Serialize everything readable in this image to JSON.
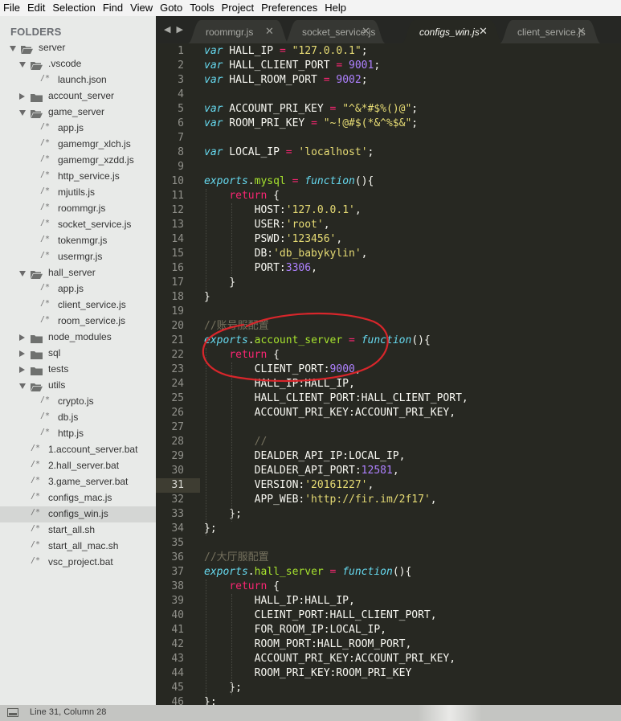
{
  "menubar": {
    "items": [
      "File",
      "Edit",
      "Selection",
      "Find",
      "View",
      "Goto",
      "Tools",
      "Project",
      "Preferences",
      "Help"
    ]
  },
  "sidebar": {
    "header": "FOLDERS",
    "tree": [
      {
        "label": "server",
        "type": "folder",
        "open": true,
        "depth": 0
      },
      {
        "label": ".vscode",
        "type": "folder",
        "open": true,
        "depth": 1
      },
      {
        "label": "launch.json",
        "type": "file",
        "depth": 2
      },
      {
        "label": "account_server",
        "type": "folder",
        "open": false,
        "depth": 1
      },
      {
        "label": "game_server",
        "type": "folder",
        "open": true,
        "depth": 1
      },
      {
        "label": "app.js",
        "type": "file",
        "depth": 2
      },
      {
        "label": "gamemgr_xlch.js",
        "type": "file",
        "depth": 2
      },
      {
        "label": "gamemgr_xzdd.js",
        "type": "file",
        "depth": 2
      },
      {
        "label": "http_service.js",
        "type": "file",
        "depth": 2
      },
      {
        "label": "mjutils.js",
        "type": "file",
        "depth": 2
      },
      {
        "label": "roommgr.js",
        "type": "file",
        "depth": 2
      },
      {
        "label": "socket_service.js",
        "type": "file",
        "depth": 2
      },
      {
        "label": "tokenmgr.js",
        "type": "file",
        "depth": 2
      },
      {
        "label": "usermgr.js",
        "type": "file",
        "depth": 2
      },
      {
        "label": "hall_server",
        "type": "folder",
        "open": true,
        "depth": 1
      },
      {
        "label": "app.js",
        "type": "file",
        "depth": 2
      },
      {
        "label": "client_service.js",
        "type": "file",
        "depth": 2
      },
      {
        "label": "room_service.js",
        "type": "file",
        "depth": 2
      },
      {
        "label": "node_modules",
        "type": "folder",
        "open": false,
        "depth": 1
      },
      {
        "label": "sql",
        "type": "folder",
        "open": false,
        "depth": 1
      },
      {
        "label": "tests",
        "type": "folder",
        "open": false,
        "depth": 1
      },
      {
        "label": "utils",
        "type": "folder",
        "open": true,
        "depth": 1
      },
      {
        "label": "crypto.js",
        "type": "file",
        "depth": 2
      },
      {
        "label": "db.js",
        "type": "file",
        "depth": 2
      },
      {
        "label": "http.js",
        "type": "file",
        "depth": 2
      },
      {
        "label": "1.account_server.bat",
        "type": "file",
        "depth": 1
      },
      {
        "label": "2.hall_server.bat",
        "type": "file",
        "depth": 1
      },
      {
        "label": "3.game_server.bat",
        "type": "file",
        "depth": 1
      },
      {
        "label": "configs_mac.js",
        "type": "file",
        "depth": 1
      },
      {
        "label": "configs_win.js",
        "type": "file",
        "depth": 1,
        "selected": true
      },
      {
        "label": "start_all.sh",
        "type": "file",
        "depth": 1
      },
      {
        "label": "start_all_mac.sh",
        "type": "file",
        "depth": 1
      },
      {
        "label": "vsc_project.bat",
        "type": "file",
        "depth": 1
      }
    ]
  },
  "tabs": {
    "nav": "◀ ▶",
    "close_glyph": "✕",
    "items": [
      {
        "label": "roommgr.js",
        "active": false
      },
      {
        "label": "socket_service.js",
        "active": false
      },
      {
        "label": "configs_win.js",
        "active": true
      },
      {
        "label": "client_service.js",
        "active": false
      }
    ]
  },
  "editor": {
    "current_line": 31,
    "lines": [
      [
        [
          "kw",
          "var"
        ],
        [
          "t",
          " HALL_IP "
        ],
        [
          "op",
          "="
        ],
        [
          "t",
          " "
        ],
        [
          "str",
          "\"127.0.0.1\""
        ],
        [
          "t",
          ";"
        ]
      ],
      [
        [
          "kw",
          "var"
        ],
        [
          "t",
          " HALL_CLIENT_PORT "
        ],
        [
          "op",
          "="
        ],
        [
          "t",
          " "
        ],
        [
          "num",
          "9001"
        ],
        [
          "t",
          ";"
        ]
      ],
      [
        [
          "kw",
          "var"
        ],
        [
          "t",
          " HALL_ROOM_PORT "
        ],
        [
          "op",
          "="
        ],
        [
          "t",
          " "
        ],
        [
          "num",
          "9002"
        ],
        [
          "t",
          ";"
        ]
      ],
      [],
      [
        [
          "kw",
          "var"
        ],
        [
          "t",
          " ACCOUNT_PRI_KEY "
        ],
        [
          "op",
          "="
        ],
        [
          "t",
          " "
        ],
        [
          "str",
          "\"^&*#$%()@\""
        ],
        [
          "t",
          ";"
        ]
      ],
      [
        [
          "kw",
          "var"
        ],
        [
          "t",
          " ROOM_PRI_KEY "
        ],
        [
          "op",
          "="
        ],
        [
          "t",
          " "
        ],
        [
          "str",
          "\"~!@#$(*&^%$&\""
        ],
        [
          "t",
          ";"
        ]
      ],
      [],
      [
        [
          "kw",
          "var"
        ],
        [
          "t",
          " LOCAL_IP "
        ],
        [
          "op",
          "="
        ],
        [
          "t",
          " "
        ],
        [
          "str",
          "'localhost'"
        ],
        [
          "t",
          ";"
        ]
      ],
      [],
      [
        [
          "obj",
          "exports"
        ],
        [
          "t",
          "."
        ],
        [
          "prop",
          "mysql"
        ],
        [
          "t",
          " "
        ],
        [
          "op",
          "="
        ],
        [
          "t",
          " "
        ],
        [
          "kw",
          "function"
        ],
        [
          "t",
          "(){"
        ]
      ],
      [
        [
          "t",
          "    "
        ],
        [
          "ret",
          "return"
        ],
        [
          "t",
          " {"
        ]
      ],
      [
        [
          "t",
          "        HOST:"
        ],
        [
          "str",
          "'127.0.0.1'"
        ],
        [
          "t",
          ","
        ]
      ],
      [
        [
          "t",
          "        USER:"
        ],
        [
          "str",
          "'root'"
        ],
        [
          "t",
          ","
        ]
      ],
      [
        [
          "t",
          "        PSWD:"
        ],
        [
          "str",
          "'123456'"
        ],
        [
          "t",
          ","
        ]
      ],
      [
        [
          "t",
          "        DB:"
        ],
        [
          "str",
          "'db_babykylin'"
        ],
        [
          "t",
          ","
        ]
      ],
      [
        [
          "t",
          "        PORT:"
        ],
        [
          "num",
          "3306"
        ],
        [
          "t",
          ","
        ]
      ],
      [
        [
          "t",
          "    }"
        ]
      ],
      [
        [
          "t",
          "}"
        ]
      ],
      [],
      [
        [
          "cmt",
          "//账号服配置"
        ]
      ],
      [
        [
          "obj",
          "exports"
        ],
        [
          "t",
          "."
        ],
        [
          "prop",
          "account_server"
        ],
        [
          "t",
          " "
        ],
        [
          "op",
          "="
        ],
        [
          "t",
          " "
        ],
        [
          "kw",
          "function"
        ],
        [
          "t",
          "(){"
        ]
      ],
      [
        [
          "t",
          "    "
        ],
        [
          "ret",
          "return"
        ],
        [
          "t",
          " {"
        ]
      ],
      [
        [
          "t",
          "        CLIENT_PORT:"
        ],
        [
          "num",
          "9000"
        ],
        [
          "t",
          ","
        ]
      ],
      [
        [
          "t",
          "        HALL_IP:HALL_IP,"
        ]
      ],
      [
        [
          "t",
          "        HALL_CLIENT_PORT:HALL_CLIENT_PORT,"
        ]
      ],
      [
        [
          "t",
          "        ACCOUNT_PRI_KEY:ACCOUNT_PRI_KEY,"
        ]
      ],
      [],
      [
        [
          "t",
          "        "
        ],
        [
          "cmt",
          "//"
        ]
      ],
      [
        [
          "t",
          "        DEALDER_API_IP:LOCAL_IP,"
        ]
      ],
      [
        [
          "t",
          "        DEALDER_API_PORT:"
        ],
        [
          "num",
          "12581"
        ],
        [
          "t",
          ","
        ]
      ],
      [
        [
          "t",
          "        VERSION:"
        ],
        [
          "str",
          "'20161227'"
        ],
        [
          "t",
          ","
        ]
      ],
      [
        [
          "t",
          "        APP_WEB:"
        ],
        [
          "str",
          "'http://fir.im/2f17'"
        ],
        [
          "t",
          ","
        ]
      ],
      [
        [
          "t",
          "    };"
        ]
      ],
      [
        [
          "t",
          "};"
        ]
      ],
      [],
      [
        [
          "cmt",
          "//大厅服配置"
        ]
      ],
      [
        [
          "obj",
          "exports"
        ],
        [
          "t",
          "."
        ],
        [
          "prop",
          "hall_server"
        ],
        [
          "t",
          " "
        ],
        [
          "op",
          "="
        ],
        [
          "t",
          " "
        ],
        [
          "kw",
          "function"
        ],
        [
          "t",
          "(){"
        ]
      ],
      [
        [
          "t",
          "    "
        ],
        [
          "ret",
          "return"
        ],
        [
          "t",
          " {"
        ]
      ],
      [
        [
          "t",
          "        HALL_IP:HALL_IP,"
        ]
      ],
      [
        [
          "t",
          "        CLEINT_PORT:HALL_CLIENT_PORT,"
        ]
      ],
      [
        [
          "t",
          "        FOR_ROOM_IP:LOCAL_IP,"
        ]
      ],
      [
        [
          "t",
          "        ROOM_PORT:HALL_ROOM_PORT,"
        ]
      ],
      [
        [
          "t",
          "        ACCOUNT_PRI_KEY:ACCOUNT_PRI_KEY,"
        ]
      ],
      [
        [
          "t",
          "        ROOM_PRI_KEY:ROOM_PRI_KEY"
        ]
      ],
      [
        [
          "t",
          "    };"
        ]
      ],
      [
        [
          "t",
          "};"
        ]
      ]
    ]
  },
  "statusbar": {
    "text": "Line 31, Column 28"
  },
  "colors": {
    "editor_bg": "#272822",
    "annotation_ring": "#d8262b"
  }
}
